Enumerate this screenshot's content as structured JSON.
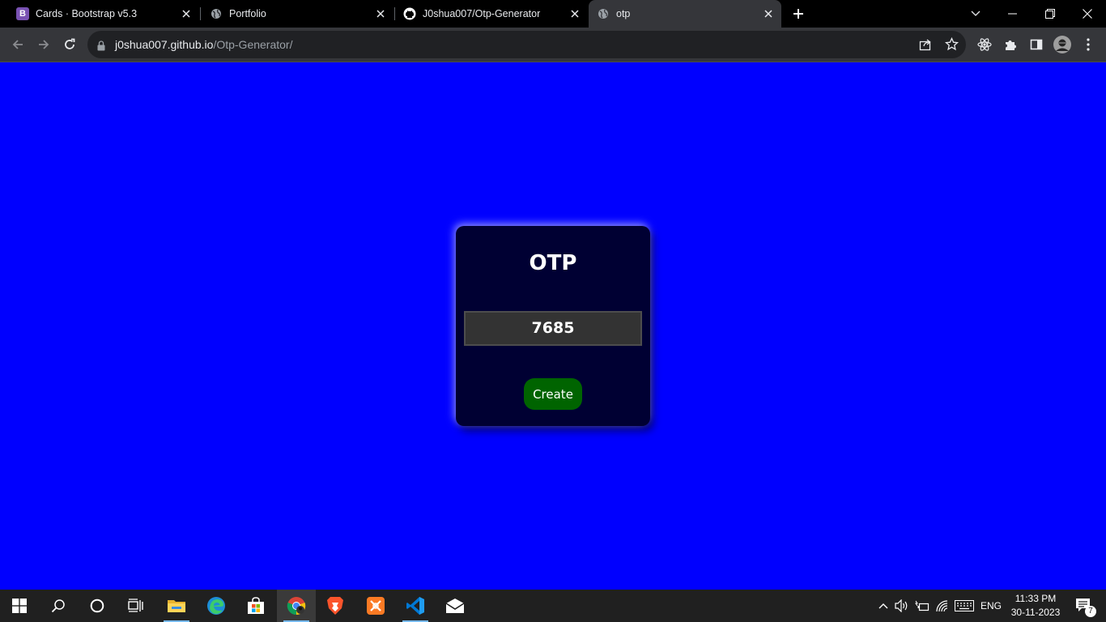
{
  "browser": {
    "tabs": [
      {
        "title": "Cards · Bootstrap v5.3",
        "favicon": "bootstrap-icon",
        "active": false
      },
      {
        "title": "Portfolio",
        "favicon": "globe-icon",
        "active": false
      },
      {
        "title": "J0shua007/Otp-Generator",
        "favicon": "github-icon",
        "active": false
      },
      {
        "title": "otp",
        "favicon": "globe-icon",
        "active": true
      }
    ],
    "bootstrap_logo_letter": "B",
    "url_host": "j0shua007.github.io",
    "url_path": "/Otp-Generator/"
  },
  "page": {
    "background_color": "#0000ff",
    "card_color": "#000033",
    "title": "OTP",
    "otp_value": "7685",
    "create_label": "Create",
    "button_color": "#006400"
  },
  "taskbar": {
    "pinned": [
      "windows-start-icon",
      "search-icon",
      "cortana-icon",
      "task-view-icon",
      "file-explorer-icon",
      "edge-icon",
      "store-icon",
      "chrome-icon",
      "brave-icon",
      "xampp-icon",
      "vscode-icon",
      "mail-icon"
    ],
    "language": "ENG",
    "time": "11:33 PM",
    "date": "30-11-2023",
    "notification_count": "7"
  }
}
